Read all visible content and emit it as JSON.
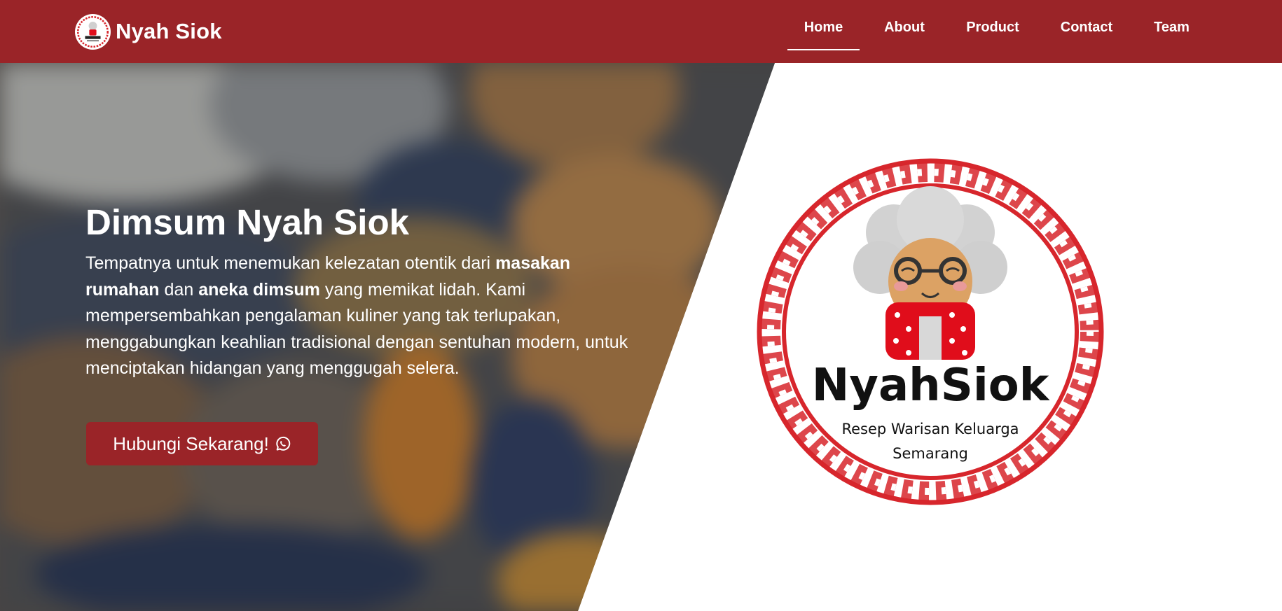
{
  "nav": {
    "brand": "Nyah Siok",
    "links": [
      "Home",
      "About",
      "Product",
      "Contact",
      "Team"
    ],
    "active": "Home"
  },
  "hero": {
    "title": "Dimsum Nyah Siok",
    "desc_1": "Tempatnya untuk menemukan kelezatan otentik dari ",
    "desc_bold_1": "masakan rumahan",
    "desc_2": " dan ",
    "desc_bold_2": "aneka dimsum",
    "desc_3": " yang memikat lidah. Kami mempersembahkan pengalaman kuliner yang tak terlupakan, menggabungkan keahlian tradisional dengan sentuhan modern, untuk menciptakan hidangan yang menggugah selera.",
    "cta_label": "Hubungi Sekarang!",
    "cta_icon": "whatsapp-icon"
  },
  "logo": {
    "name": "NyahSiok",
    "tagline_1": "Resep Warisan Keluarga",
    "tagline_2": "Semarang"
  },
  "colors": {
    "brand_red": "#9a2428",
    "white": "#ffffff",
    "logo_red": "#d7262c"
  }
}
